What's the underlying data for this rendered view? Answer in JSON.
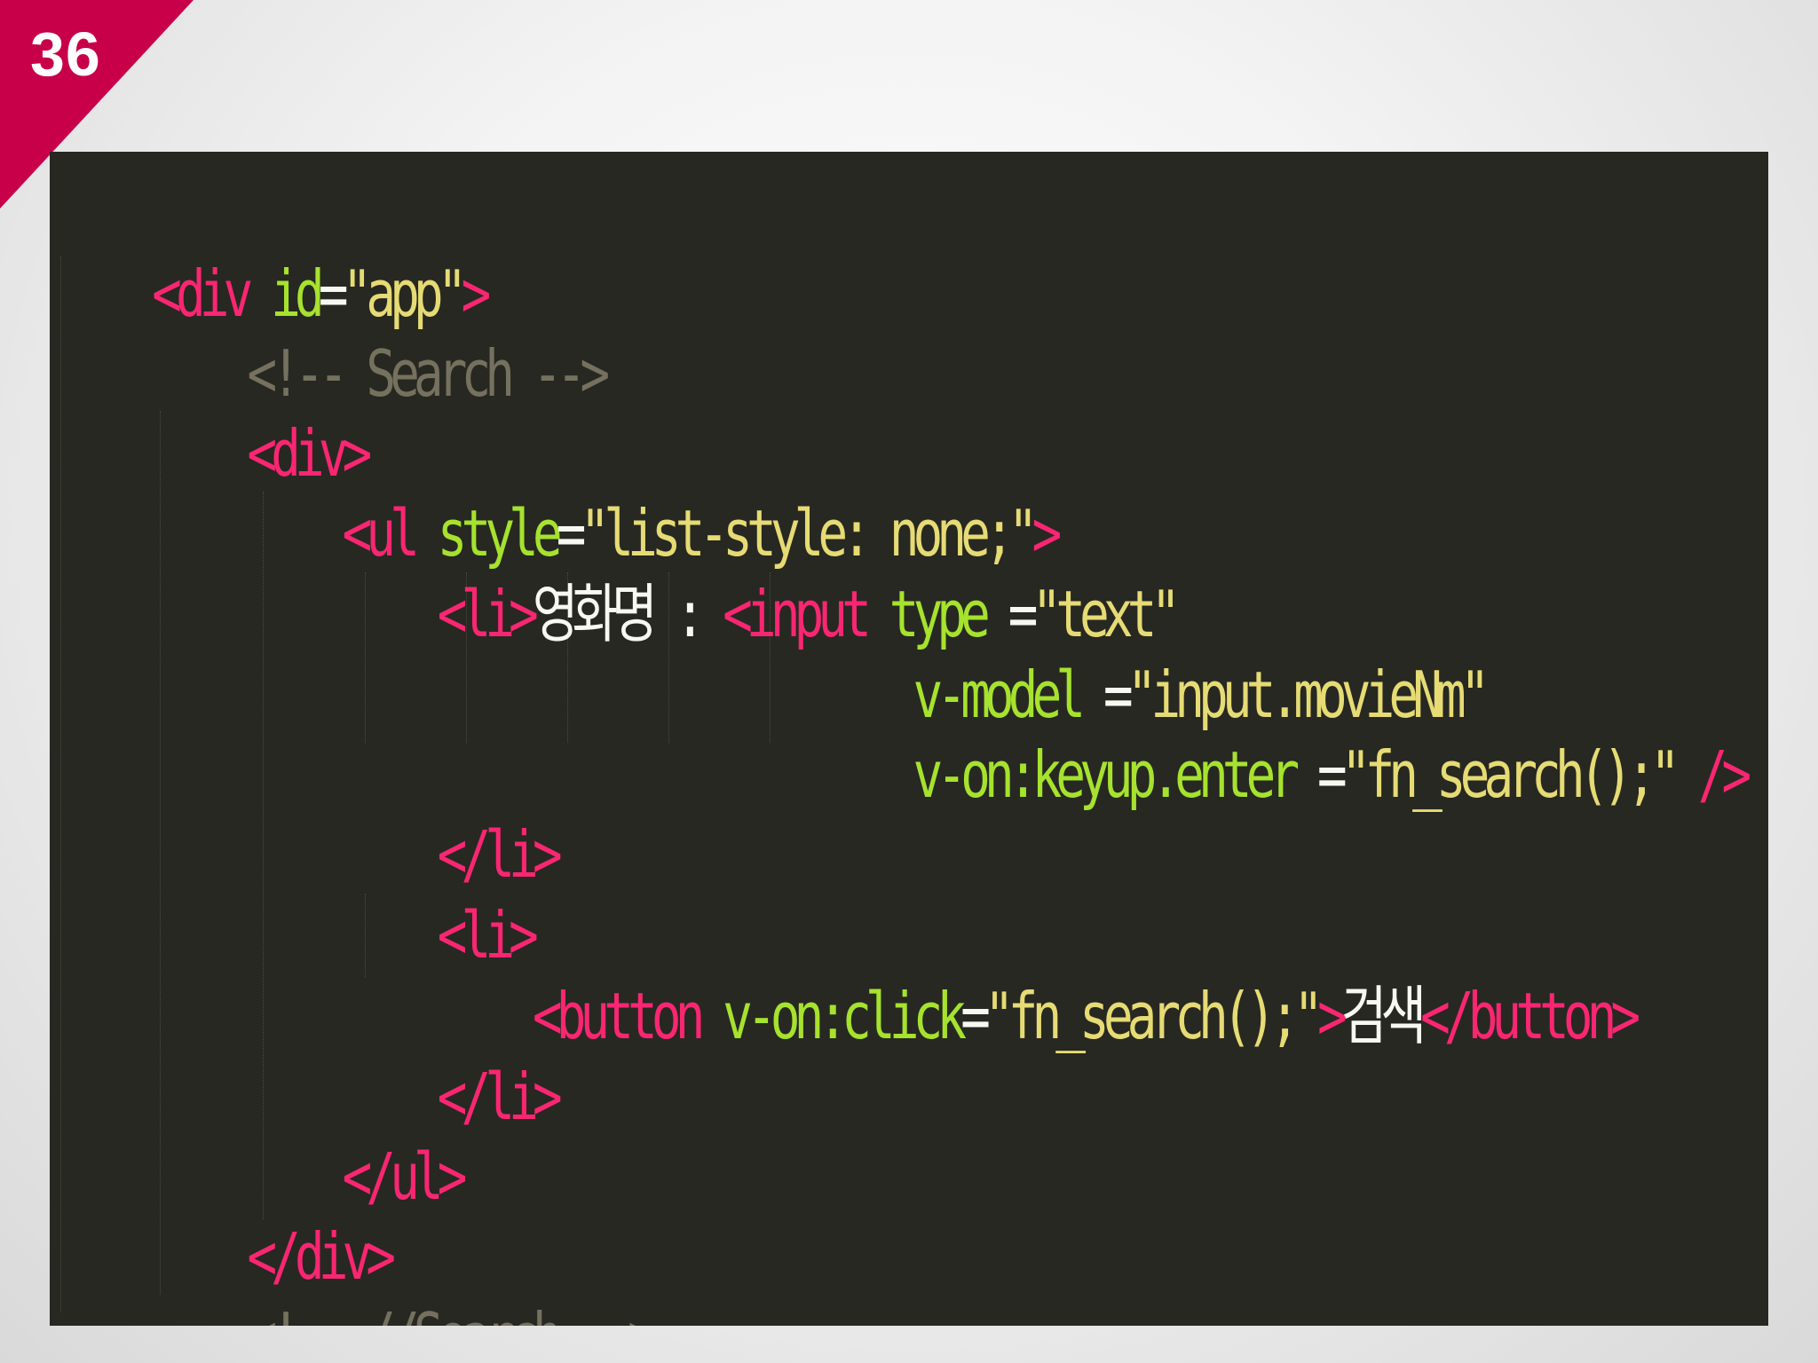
{
  "slide": {
    "number": "36"
  },
  "editor": {
    "theme": {
      "background": "#272822",
      "tag": "#f92672",
      "attribute": "#a6e22e",
      "string": "#e6db74",
      "text": "#f8f8f2",
      "comment": "#75715e"
    },
    "lines": [
      {
        "indent": "",
        "segments": [
          {
            "type": "tag",
            "text": "<div "
          },
          {
            "type": "attr",
            "text": "id"
          },
          {
            "type": "eq",
            "text": "="
          },
          {
            "type": "str",
            "text": "\"app\""
          },
          {
            "type": "tag",
            "text": ">"
          }
        ]
      },
      {
        "indent": "    ",
        "segments": [
          {
            "type": "comment",
            "text": "<!-- Search -->"
          }
        ]
      },
      {
        "indent": "    ",
        "segments": [
          {
            "type": "tag",
            "text": "<div>"
          }
        ]
      },
      {
        "indent": "        ",
        "segments": [
          {
            "type": "tag",
            "text": "<ul "
          },
          {
            "type": "attr",
            "text": "style"
          },
          {
            "type": "eq",
            "text": "="
          },
          {
            "type": "str",
            "text": "\"list-style: none;\""
          },
          {
            "type": "tag",
            "text": ">"
          }
        ]
      },
      {
        "indent": "            ",
        "segments": [
          {
            "type": "tag",
            "text": "<li>"
          },
          {
            "type": "txt",
            "text": "영화명 : "
          },
          {
            "type": "tag",
            "text": "<input "
          },
          {
            "type": "attr",
            "text": "type"
          },
          {
            "type": "eq",
            "text": " ="
          },
          {
            "type": "str",
            "text": "\"text\""
          }
        ]
      },
      {
        "indent": "                                ",
        "segments": [
          {
            "type": "attr",
            "text": "v-model"
          },
          {
            "type": "eq",
            "text": " ="
          },
          {
            "type": "str",
            "text": "\"input.movieNm\""
          }
        ]
      },
      {
        "indent": "                                ",
        "segments": [
          {
            "type": "attr",
            "text": "v-on:keyup.enter"
          },
          {
            "type": "eq",
            "text": " ="
          },
          {
            "type": "str",
            "text": "\"fn_search();\""
          },
          {
            "type": "tag",
            "text": " />"
          }
        ]
      },
      {
        "indent": "            ",
        "segments": [
          {
            "type": "tag",
            "text": "</li>"
          }
        ]
      },
      {
        "indent": "            ",
        "segments": [
          {
            "type": "tag",
            "text": "<li>"
          }
        ]
      },
      {
        "indent": "                ",
        "segments": [
          {
            "type": "tag",
            "text": "<button "
          },
          {
            "type": "attr",
            "text": "v-on:click"
          },
          {
            "type": "eq",
            "text": "="
          },
          {
            "type": "str",
            "text": "\"fn_search();\""
          },
          {
            "type": "tag",
            "text": ">"
          },
          {
            "type": "txt",
            "text": "검색"
          },
          {
            "type": "tag",
            "text": "</button>"
          }
        ]
      },
      {
        "indent": "            ",
        "segments": [
          {
            "type": "tag",
            "text": "</li>"
          }
        ]
      },
      {
        "indent": "        ",
        "segments": [
          {
            "type": "tag",
            "text": "</ul>"
          }
        ]
      },
      {
        "indent": "    ",
        "segments": [
          {
            "type": "tag",
            "text": "</div>"
          }
        ]
      },
      {
        "indent": "    ",
        "segments": [
          {
            "type": "comment",
            "text": "<!-- //Search -->"
          }
        ]
      }
    ]
  }
}
